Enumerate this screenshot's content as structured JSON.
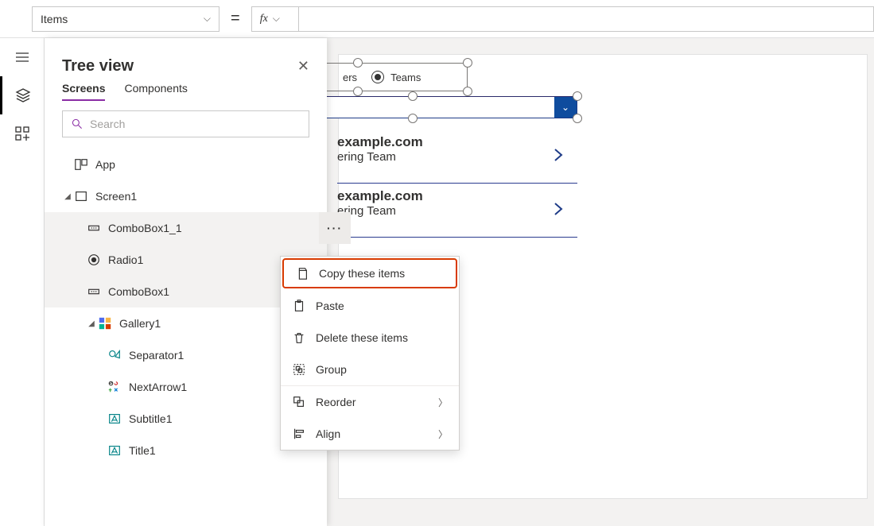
{
  "formula": {
    "property": "Items"
  },
  "panel": {
    "title": "Tree view",
    "tabs": {
      "screens": "Screens",
      "components": "Components"
    },
    "searchPlaceholder": "Search"
  },
  "tree": {
    "app": "App",
    "screen1": "Screen1",
    "combobox1_1": "ComboBox1_1",
    "radio1": "Radio1",
    "combobox1": "ComboBox1",
    "gallery1": "Gallery1",
    "separator1": "Separator1",
    "nextarrow1": "NextArrow1",
    "subtitle1": "Subtitle1",
    "title1": "Title1"
  },
  "canvas": {
    "radio": {
      "opt1": "ers",
      "opt2": "Teams"
    },
    "item1": {
      "title": "example.com",
      "sub": "ering Team"
    },
    "item2": {
      "title": "example.com",
      "sub": "ering Team"
    }
  },
  "menu": {
    "copy": "Copy these items",
    "paste": "Paste",
    "delete": "Delete these items",
    "group": "Group",
    "reorder": "Reorder",
    "align": "Align"
  }
}
